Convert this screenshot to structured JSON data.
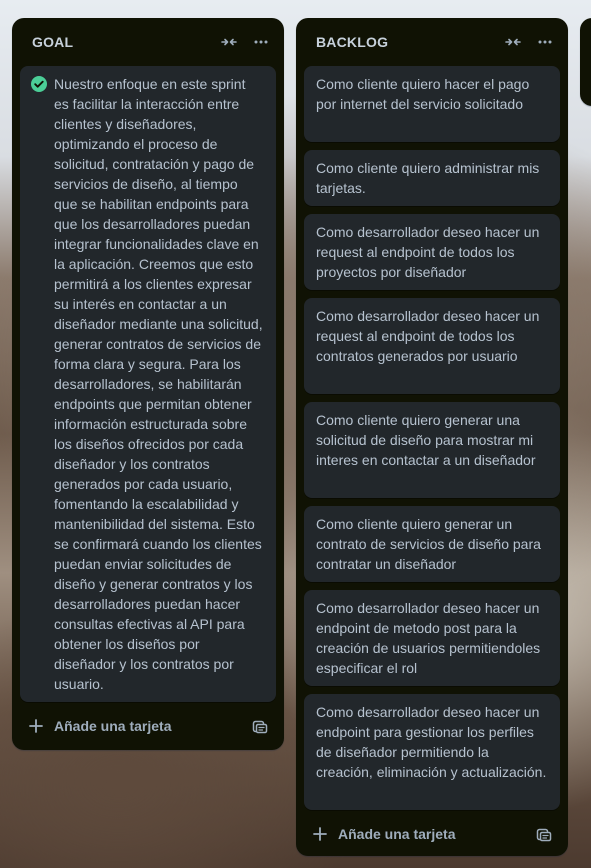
{
  "lists": {
    "goal": {
      "title": "GOAL",
      "card_text": "Nuestro enfoque en este sprint es facilitar la interacción entre clientes y diseñadores, optimizando el proceso de solicitud, contratación y pago de servicios de diseño, al tiempo que se habilitan endpoints para que los desarrolladores puedan integrar funcionalidades clave en la aplicación. Creemos que esto permitirá a los clientes expresar su interés en contactar a un diseñador mediante una solicitud, generar contratos de servicios de forma clara y segura. Para los desarrolladores, se habilitarán endpoints que permitan obtener información estructurada sobre los diseños ofrecidos por cada diseñador y los contratos generados por cada usuario, fomentando la escalabilidad y mantenibilidad del sistema. Esto se confirmará cuando los clientes puedan enviar solicitudes de diseño y generar contratos y los desarrolladores puedan hacer consultas efectivas al API para obtener los diseños por diseñador y los contratos por usuario.",
      "card_icon": "check-circle-icon",
      "add_card_label": "Añade una tarjeta"
    },
    "backlog": {
      "title": "BACKLOG",
      "cards": [
        "Como cliente quiero hacer el pago por internet del servicio solicitado",
        "Como cliente quiero administrar mis tarjetas.",
        "Como desarrollador deseo hacer un request al endpoint de todos los proyectos por diseñador",
        "Como desarrollador deseo hacer un request al endpoint de todos los contratos generados por usuario",
        "Como cliente quiero generar una solicitud de diseño para mostrar mi interes en contactar a un diseñador",
        "Como cliente quiero generar un contrato de servicios de diseño para contratar un diseñador",
        "Como desarrollador deseo hacer un endpoint de metodo post para la creación de usuarios permitiendoles especificar el rol",
        "Como desarrollador deseo hacer un endpoint para gestionar los perfiles de diseñador permitiendo la creación, eliminación y actualización."
      ],
      "add_card_label": "Añade una tarjeta"
    }
  },
  "colors": {
    "list_bg": "#101204",
    "card_bg": "#22272b",
    "text": "#b6c2cf",
    "check_green": "#4bce97"
  }
}
